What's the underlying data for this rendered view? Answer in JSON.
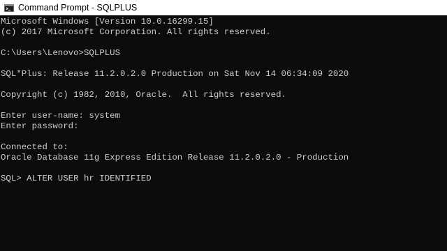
{
  "window": {
    "title": "Command Prompt - SQLPLUS",
    "icon": "command-prompt-icon"
  },
  "console": {
    "lines": [
      "Microsoft Windows [Version 10.0.16299.15]",
      "(c) 2017 Microsoft Corporation. All rights reserved.",
      "",
      "C:\\Users\\Lenovo>SQLPLUS",
      "",
      "SQL*Plus: Release 11.2.0.2.0 Production on Sat Nov 14 06:34:09 2020",
      "",
      "Copyright (c) 1982, 2010, Oracle.  All rights reserved.",
      "",
      "Enter user-name: system",
      "Enter password:",
      "",
      "Connected to:",
      "Oracle Database 11g Express Edition Release 11.2.0.2.0 - Production",
      "",
      "SQL> ALTER USER hr IDENTIFIED"
    ]
  },
  "colors": {
    "background": "#0c0c0c",
    "text": "#cccccc",
    "titlebar": "#ffffff"
  }
}
